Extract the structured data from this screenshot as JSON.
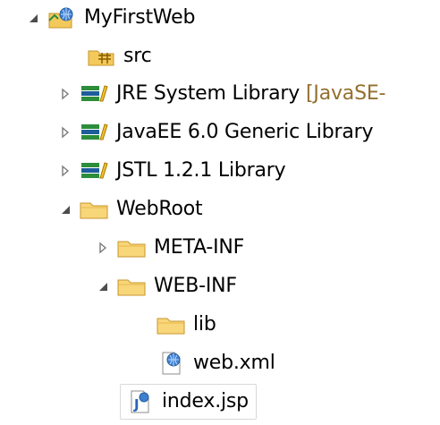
{
  "tree": {
    "root": {
      "label": "MyFirstWeb",
      "icon": "web-project-icon",
      "expanded": true
    },
    "items": [
      {
        "label": "src",
        "icon": "source-folder-icon"
      },
      {
        "label": "JRE System Library",
        "decoration": "[JavaSE-",
        "icon": "library-icon",
        "expanded": false
      },
      {
        "label": "JavaEE 6.0 Generic Library",
        "icon": "library-icon",
        "expanded": false
      },
      {
        "label": "JSTL 1.2.1 Library",
        "icon": "library-icon",
        "expanded": false
      },
      {
        "label": "WebRoot",
        "icon": "folder-icon",
        "expanded": true
      },
      {
        "label": "META-INF",
        "icon": "folder-icon",
        "expanded": false
      },
      {
        "label": "WEB-INF",
        "icon": "folder-icon",
        "expanded": true
      },
      {
        "label": "lib",
        "icon": "folder-icon"
      },
      {
        "label": "web.xml",
        "icon": "xml-file-icon"
      },
      {
        "label": "index.jsp",
        "icon": "jsp-file-icon",
        "selected": true
      }
    ]
  },
  "colors": {
    "decoration": "#946f2f",
    "folder": "#f3c95b",
    "folder_border": "#c7962c",
    "globe": "#3f7fd0",
    "library_blue": "#1d5d9a",
    "library_green": "#2c8d3b"
  }
}
